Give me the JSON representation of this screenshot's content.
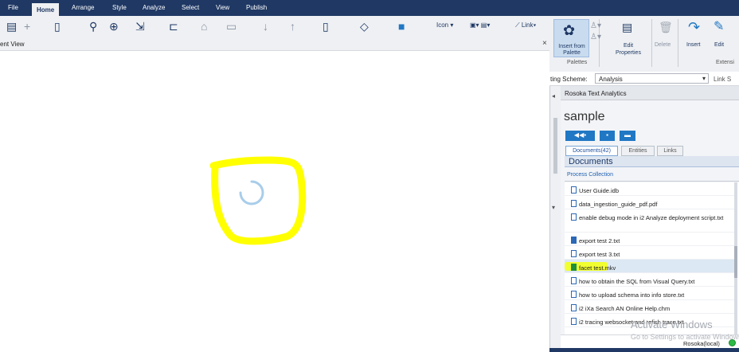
{
  "menu": {
    "tabs": [
      {
        "label": "File"
      },
      {
        "label": "Home"
      },
      {
        "label": "Arrange"
      },
      {
        "label": "Style"
      },
      {
        "label": "Analyze"
      },
      {
        "label": "Select"
      },
      {
        "label": "View"
      },
      {
        "label": "Publish"
      }
    ],
    "active_tab": "Home"
  },
  "ribbon": {
    "icon_dropdown": "Icon",
    "link_dropdown": "Link",
    "insert_from_palette": "Insert from\nPalette",
    "palettes_group": "Palettes",
    "edit_properties": "Edit\nProperties",
    "delete": "Delete",
    "insert": "Insert",
    "edit": "Edit",
    "extensions_group": "Extensi"
  },
  "document_view": {
    "title": "ent View",
    "close_glyph": "×"
  },
  "scheme_bar": {
    "label": "ting Scheme:",
    "value": "Analysis",
    "link_text": "Link S"
  },
  "rosoka": {
    "header": "Rosoka Text Analytics",
    "title": "sample",
    "tabs": [
      {
        "label": "Documents(42)"
      },
      {
        "label": "Entities"
      },
      {
        "label": "Links"
      }
    ],
    "section_title": "Documents",
    "process_link": "Process Collection",
    "documents": [
      {
        "name": "User Guide.idb",
        "icon": "file-outline-icon"
      },
      {
        "name": "data_ingestion_guide_pdf.pdf",
        "icon": "file-outline-icon"
      },
      {
        "name": "enable debug mode in i2 Analyze deployment script.txt",
        "icon": "file-outline-icon"
      },
      {
        "name": "export test 2.txt",
        "icon": "file-filled-icon"
      },
      {
        "name": "export test 3.txt",
        "icon": "file-outline-icon"
      },
      {
        "name": "facet test.mkv",
        "icon": "file-green-icon",
        "selected": true
      },
      {
        "name": "how to obtain the SQL from Visual Query.txt",
        "icon": "file-outline-icon"
      },
      {
        "name": "how to upload schema into info store.txt",
        "icon": "file-outline-icon"
      },
      {
        "name": "i2 iXa Search AN Online Help.chm",
        "icon": "file-outline-icon"
      },
      {
        "name": "i2 tracing websocket and refish trace.txt",
        "icon": "file-outline-icon"
      }
    ],
    "status": "Rosoka(local)"
  },
  "watermark": {
    "line1": "Activate Windows",
    "line2": "Go to Settings to activate Windows."
  },
  "colors": {
    "menubar": "#1f3864",
    "accent_button": "#2077c4",
    "annotation": "#ffff00",
    "status_ok": "#2bbb45"
  }
}
